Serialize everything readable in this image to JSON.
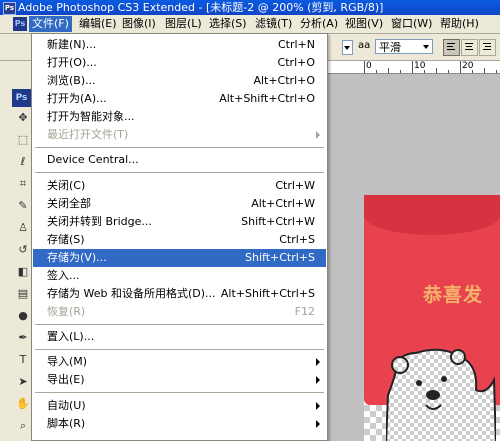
{
  "window": {
    "title": "Adobe Photoshop CS3 Extended - [未标题-2 @ 200% (剪到, RGB/8)]",
    "ps_logo": "Ps"
  },
  "menubar": {
    "items": [
      {
        "label": "文件(F)",
        "active": true
      },
      {
        "label": "编辑(E)"
      },
      {
        "label": "图像(I)"
      },
      {
        "label": "图层(L)"
      },
      {
        "label": "选择(S)"
      },
      {
        "label": "滤镜(T)"
      },
      {
        "label": "分析(A)"
      },
      {
        "label": "视图(V)"
      },
      {
        "label": "窗口(W)"
      },
      {
        "label": "帮助(H)"
      }
    ]
  },
  "options": {
    "aa_label": "aa",
    "font_smoothing": "平滑"
  },
  "ruler": {
    "labels": [
      "0",
      "10",
      "20"
    ]
  },
  "canvas": {
    "greeting_text": "恭喜发"
  },
  "file_menu": {
    "items": [
      {
        "label": "新建(N)...",
        "shortcut": "Ctrl+N"
      },
      {
        "label": "打开(O)...",
        "shortcut": "Ctrl+O"
      },
      {
        "label": "浏览(B)...",
        "shortcut": "Alt+Ctrl+O"
      },
      {
        "label": "打开为(A)...",
        "shortcut": "Alt+Shift+Ctrl+O"
      },
      {
        "label": "打开为智能对象...",
        "shortcut": ""
      },
      {
        "label": "最近打开文件(T)",
        "shortcut": "",
        "submenu": true,
        "disabled": true
      },
      {
        "separator": true
      },
      {
        "label": "Device Central...",
        "shortcut": ""
      },
      {
        "separator": true
      },
      {
        "label": "关闭(C)",
        "shortcut": "Ctrl+W"
      },
      {
        "label": "关闭全部",
        "shortcut": "Alt+Ctrl+W"
      },
      {
        "label": "关闭并转到 Bridge...",
        "shortcut": "Shift+Ctrl+W"
      },
      {
        "label": "存储(S)",
        "shortcut": "Ctrl+S"
      },
      {
        "label": "存储为(V)...",
        "shortcut": "Shift+Ctrl+S",
        "highlighted": true
      },
      {
        "label": "签入...",
        "shortcut": ""
      },
      {
        "label": "存储为 Web 和设备所用格式(D)...",
        "shortcut": "Alt+Shift+Ctrl+S"
      },
      {
        "label": "恢复(R)",
        "shortcut": "F12",
        "disabled": true
      },
      {
        "separator": true
      },
      {
        "label": "置入(L)...",
        "shortcut": ""
      },
      {
        "separator": true
      },
      {
        "label": "导入(M)",
        "shortcut": "",
        "submenu": true
      },
      {
        "label": "导出(E)",
        "shortcut": "",
        "submenu": true
      },
      {
        "separator": true
      },
      {
        "label": "自动(U)",
        "shortcut": "",
        "submenu": true
      },
      {
        "label": "脚本(R)",
        "shortcut": "",
        "submenu": true
      }
    ]
  },
  "colors": {
    "highlight": "#316ac5",
    "titlebar": "#0a5be0",
    "can_red": "#e8424f",
    "greeting": "#f4b26a"
  }
}
